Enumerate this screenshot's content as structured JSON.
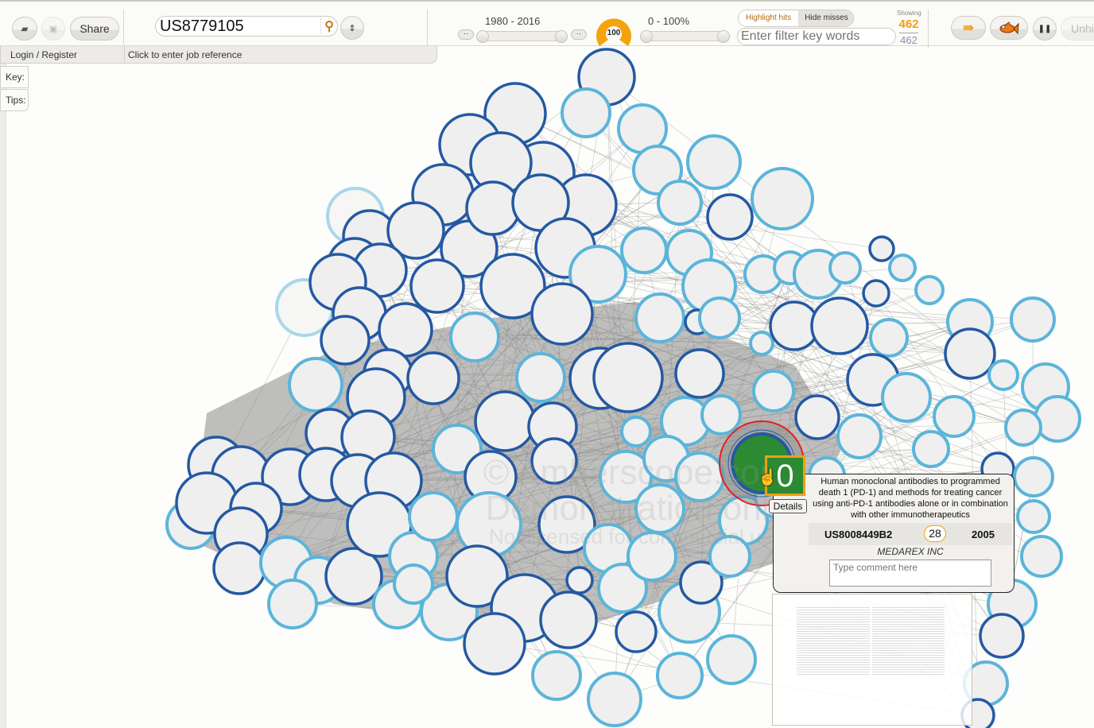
{
  "toolbar": {
    "open_icon": "folder-open-icon",
    "save_icon": "save-icon",
    "share_label": "Share",
    "search_value": "US8779105",
    "search_icon": "search-icon",
    "search_toggle_icon": "chevron-up-down-icon",
    "date_range_label": "1980 - 2016",
    "date_range": {
      "min": 1980,
      "max": 2016
    },
    "date_step_left_label": "··",
    "date_step_right_label": "··",
    "gauge_value": "100",
    "relevance_range_label": "0 - 100%",
    "relevance_range": {
      "min": 0,
      "max": 100
    },
    "highlight_hits_label": "Highlight hits",
    "hide_misses_label": "Hide misses",
    "filter_placeholder": "Enter filter key words",
    "showing_label": "Showing",
    "showing_count": "462",
    "total_count": "462",
    "import_icon": "import-arrow-icon",
    "fish_icon": "goldfish-icon",
    "pause_icon": "pause-icon",
    "unhide_label": "Unhide"
  },
  "subbar": {
    "login_label": "Login / Register",
    "job_reference_label": "Click to enter job reference"
  },
  "side_tabs": {
    "key_label": "Key:",
    "tips_label": "Tips:"
  },
  "watermark": {
    "line1": "© Amberscope.com",
    "line2": "Demonstration only",
    "line3": "Not licensed for commercial use"
  },
  "selected_node": {
    "badge_value": "0",
    "details_label": "Details",
    "title": "Human monoclonal antibodies to programmed death 1 (PD-1) and methods for treating cancer using anti-PD-1 antibodies alone or in combination with other immunotherapeutics",
    "patent_number": "US8008449B2",
    "citation_count": "28",
    "year": "2005",
    "assignee": "MEDAREX INC",
    "comment_placeholder": "Type comment here"
  },
  "colors": {
    "dark_node": "#2459a3",
    "light_node": "#5bb5da",
    "faint_node": "#a9d6ea",
    "node_fill": "#efefef",
    "selected_fill": "#2c8a33",
    "accent_orange": "#f0a010",
    "selected_ring": "#e02020"
  }
}
